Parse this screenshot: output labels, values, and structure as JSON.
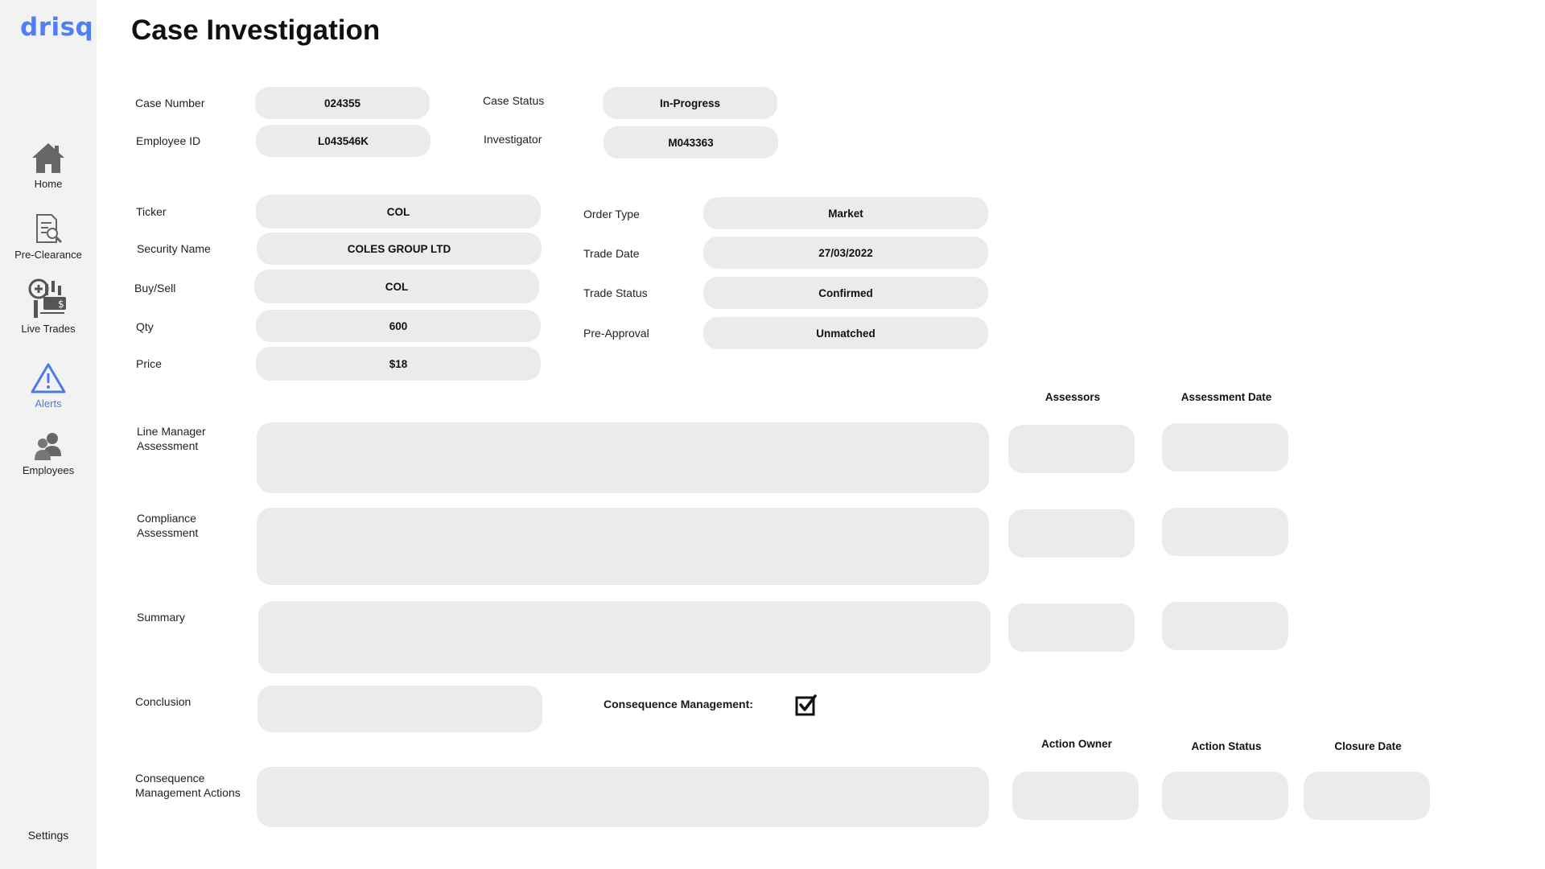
{
  "app": {
    "logo": "drisq"
  },
  "nav": {
    "home": "Home",
    "pre_clearance": "Pre-Clearance",
    "live_trades": "Live Trades",
    "alerts": "Alerts",
    "employees": "Employees",
    "settings": "Settings"
  },
  "page": {
    "title": "Case Investigation"
  },
  "case": {
    "case_number_label": "Case Number",
    "case_number": "024355",
    "case_status_label": "Case Status",
    "case_status": "In-Progress",
    "employee_id_label": "Employee ID",
    "employee_id": "L043546K",
    "investigator_label": "Investigator",
    "investigator": "M043363"
  },
  "trade": {
    "ticker_label": "Ticker",
    "ticker": "COL",
    "security_name_label": "Security Name",
    "security_name": "COLES GROUP LTD",
    "buy_sell_label": "Buy/Sell",
    "buy_sell": "COL",
    "qty_label": "Qty",
    "qty": "600",
    "price_label": "Price",
    "price": "$18",
    "order_type_label": "Order Type",
    "order_type": "Market",
    "trade_date_label": "Trade Date",
    "trade_date": "27/03/2022",
    "trade_status_label": "Trade Status",
    "trade_status": "Confirmed",
    "pre_approval_label": "Pre-Approval",
    "pre_approval": "Unmatched"
  },
  "assessment": {
    "assessors_header": "Assessors",
    "assessment_date_header": "Assessment Date",
    "line_manager_label_1": "Line Manager",
    "line_manager_label_2": "Assessment",
    "compliance_label_1": "Compliance",
    "compliance_label_2": "Assessment",
    "summary_label": "Summary",
    "conclusion_label": "Conclusion",
    "consequence_management_label": "Consequence Management:",
    "consequence_management_checked": true
  },
  "actions": {
    "label_1": "Consequence",
    "label_2": "Management Actions",
    "action_owner_header": "Action Owner",
    "action_status_header": "Action Status",
    "closure_date_header": "Closure Date"
  },
  "colors": {
    "accent": "#4f7ef7",
    "field_bg": "#ebebeb",
    "sidebar_bg": "#f2f2f2"
  }
}
